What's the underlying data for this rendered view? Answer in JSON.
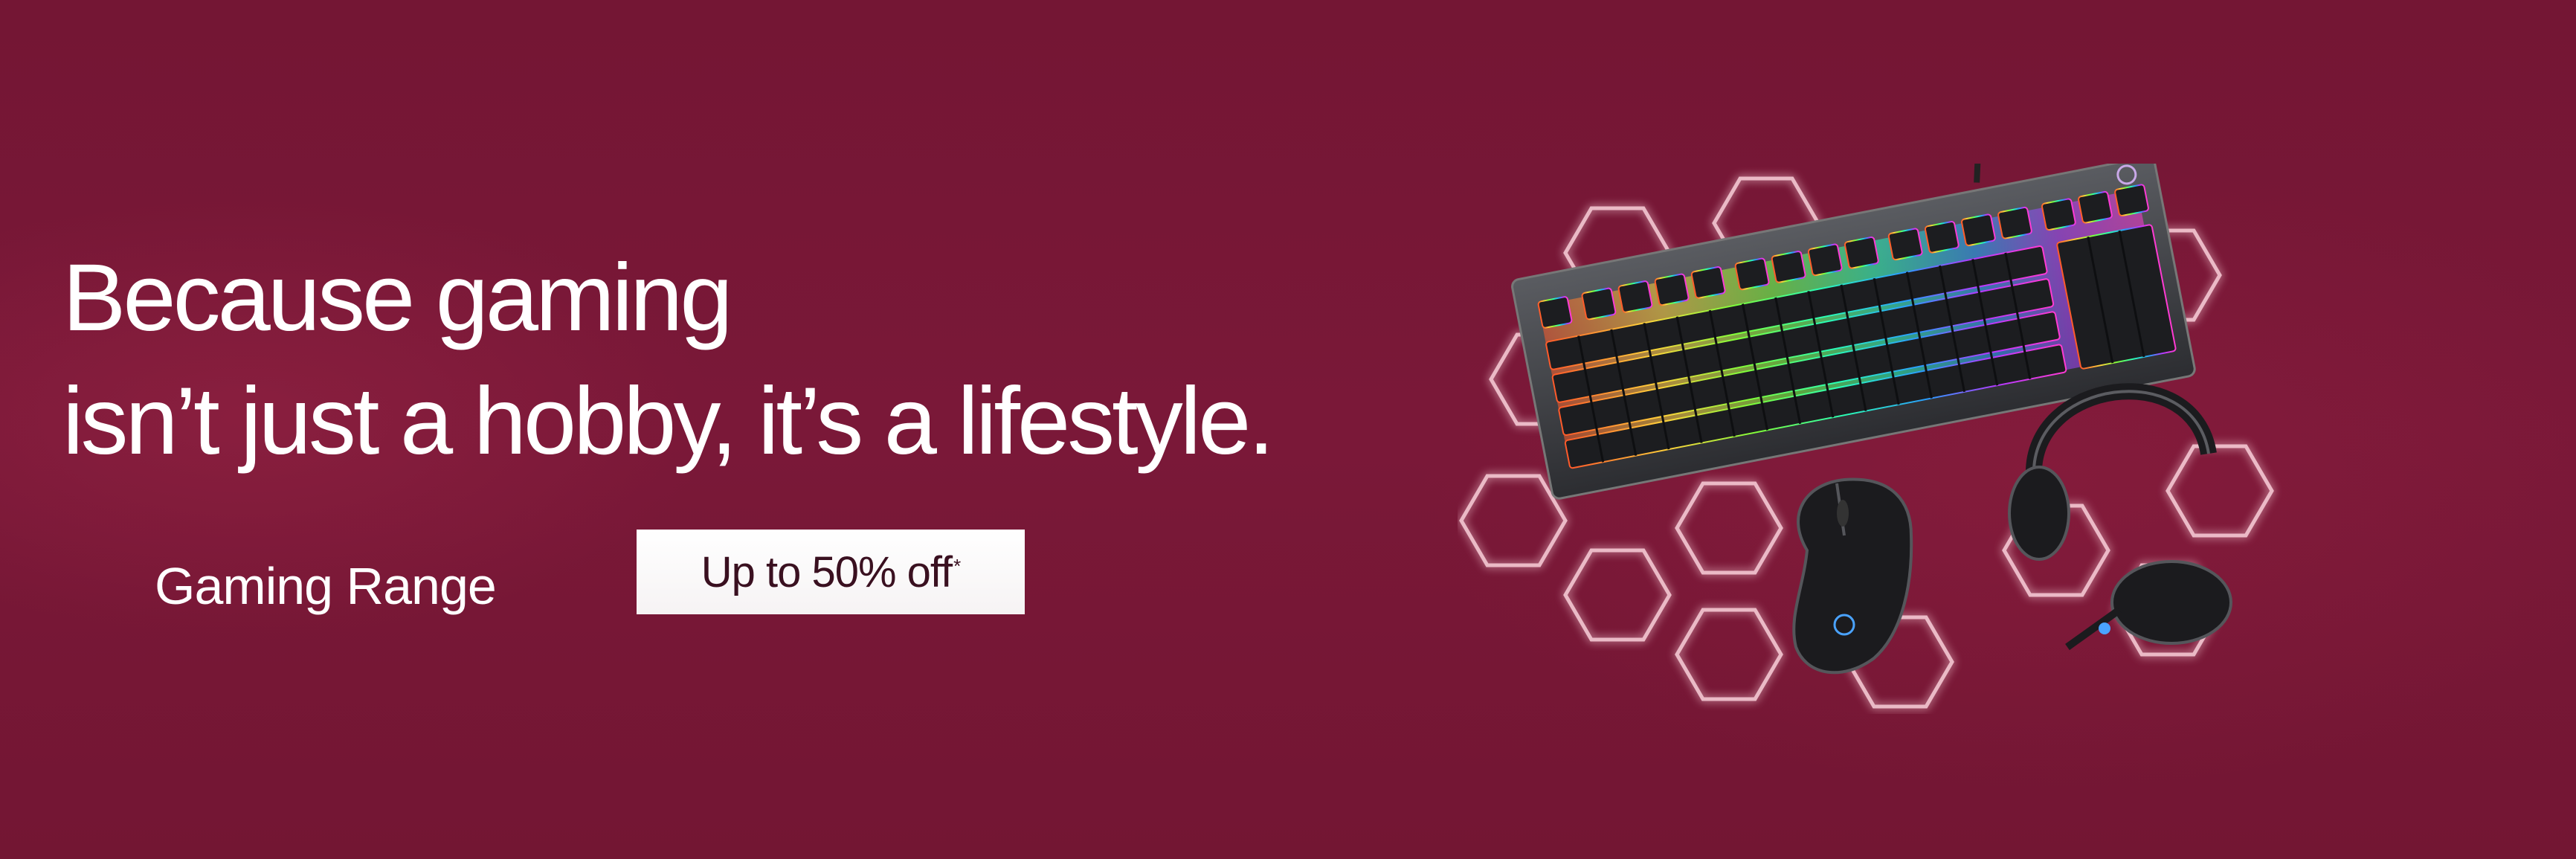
{
  "banner": {
    "headline_line1": "Because gaming",
    "headline_line2": "isn’t just a hobby, it’s a lifestyle.",
    "range_label": "Gaming Range",
    "offer_label": "Up to 50% off",
    "offer_asterisk": "*",
    "colors": {
      "background": "#751734",
      "text": "#ffffff",
      "button_bg": "#ffffff",
      "button_text": "#3a1020",
      "hex_glow": "#ffd7e0"
    },
    "product_icons": [
      "hexagon-pattern",
      "gaming-keyboard",
      "gaming-mouse",
      "gaming-headset"
    ]
  }
}
